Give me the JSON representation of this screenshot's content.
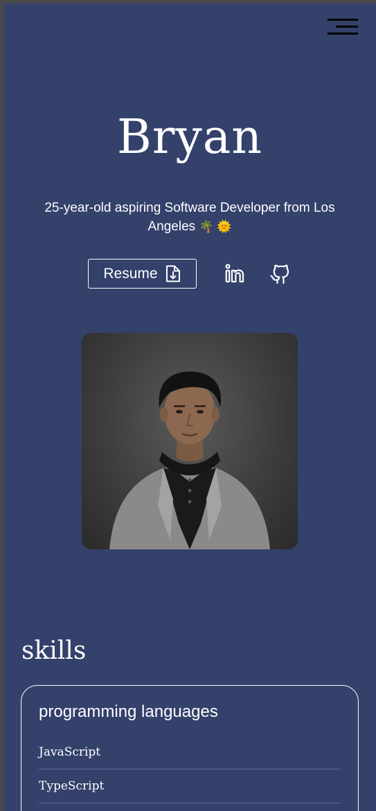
{
  "header": {
    "menu_icon": "hamburger-menu-icon"
  },
  "hero": {
    "name": "Bryan",
    "tagline": "25-year-old aspiring Software Developer from Los Angeles",
    "tagline_emojis": "🌴 🌞",
    "resume_label": "Resume",
    "resume_icon": "file-download-icon",
    "linkedin_icon": "linkedin-icon",
    "github_icon": "github-icon"
  },
  "photo": {
    "alt": "portrait photo"
  },
  "skills": {
    "title": "skills",
    "cards": [
      {
        "title": "programming languages",
        "items": [
          "JavaScript",
          "TypeScript"
        ]
      }
    ]
  },
  "colors": {
    "background": "#33416b",
    "text": "#ffffff",
    "divider": "#5d6a92",
    "menu_bars": "#000000"
  }
}
